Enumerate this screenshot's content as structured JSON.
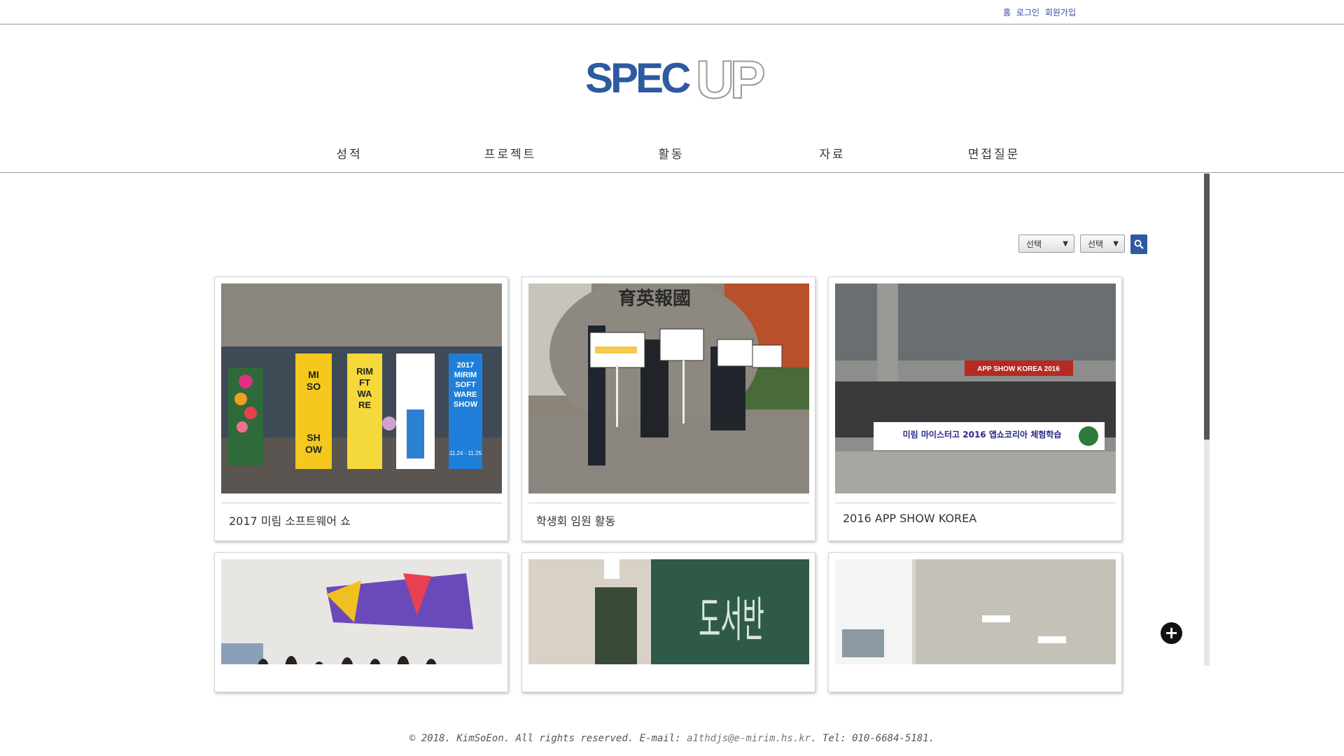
{
  "topbar": {
    "home": "홈",
    "login": "로그인",
    "signup": "회원가입"
  },
  "logo": {
    "part1": "SPEC",
    "part2": "UP"
  },
  "nav": [
    {
      "label": "성적"
    },
    {
      "label": "프로젝트"
    },
    {
      "label": "활동"
    },
    {
      "label": "자료"
    },
    {
      "label": "면접질문"
    }
  ],
  "filters": {
    "select1": "선택",
    "select2": "선택"
  },
  "cards": [
    {
      "caption": "2017 미림 소프트웨어 쇼"
    },
    {
      "caption": "학생회 임원 활동"
    },
    {
      "caption": "2016 APP SHOW KOREA"
    },
    {
      "caption": ""
    },
    {
      "caption": ""
    },
    {
      "caption": ""
    }
  ],
  "photo_text": {
    "banner1": "MI SO SHOW",
    "banner2": "RIM FT WA RE",
    "banner4": "2017 MIRIM SOFT WARE SHOW",
    "banner4_dates": "11.24 - 11.25",
    "stone": "育英報國",
    "appshow_sign": "APP SHOW KOREA 2016",
    "appshow_banner": "미림 마이스터고 2016 앱쇼코리아 체험학습",
    "classroom_board": "도서반"
  },
  "footer": {
    "prefix": "© 2018. KimSoEon. All rights reserved. E-mail: ",
    "email": "a1thdjs@e-mirim.hs.kr",
    "suffix": ". Tel: 010-6684-5181."
  },
  "colors": {
    "brand_blue": "#2d5aa0",
    "nav_text": "#333333",
    "link": "#3848a0"
  }
}
